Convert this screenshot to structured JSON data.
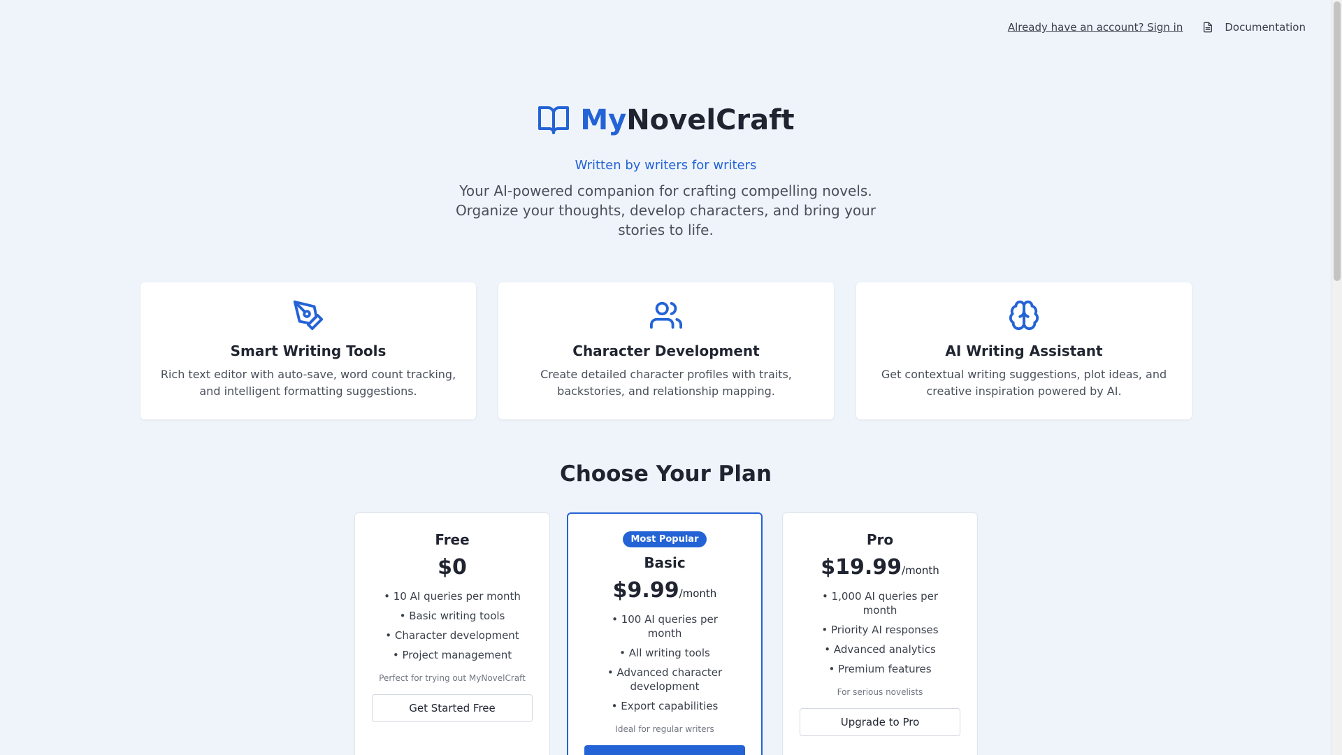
{
  "topnav": {
    "signin_link": "Already have an account? Sign in",
    "documentation": "Documentation"
  },
  "hero": {
    "brand_my": "My",
    "brand_rest": "NovelCraft",
    "tagline": "Written by writers for writers",
    "description": "Your AI-powered companion for crafting compelling novels. Organize your thoughts, develop characters, and bring your stories to life."
  },
  "features": [
    {
      "title": "Smart Writing Tools",
      "description": "Rich text editor with auto-save, word count tracking, and intelligent formatting suggestions.",
      "icon": "pen-tool-icon"
    },
    {
      "title": "Character Development",
      "description": "Create detailed character profiles with traits, backstories, and relationship mapping.",
      "icon": "users-icon"
    },
    {
      "title": "AI Writing Assistant",
      "description": "Get contextual writing suggestions, plot ideas, and creative inspiration powered by AI.",
      "icon": "brain-icon"
    }
  ],
  "plans_title": "Choose Your Plan",
  "plans": [
    {
      "name": "Free",
      "price": "$0",
      "period": "",
      "features": [
        "• 10 AI queries per month",
        "• Basic writing tools",
        "• Character development",
        "• Project management"
      ],
      "note": "Perfect for trying out MyNovelCraft",
      "button": "Get Started Free"
    },
    {
      "badge": "Most Popular",
      "name": "Basic",
      "price": "$9.99",
      "period": "/month",
      "features": [
        "• 100 AI queries per month",
        "• All writing tools",
        "• Advanced character development",
        "• Export capabilities"
      ],
      "note": "Ideal for regular writers",
      "button": ""
    },
    {
      "name": "Pro",
      "price": "$19.99",
      "period": "/month",
      "features": [
        "• 1,000 AI queries per month",
        "• Priority AI responses",
        "• Advanced analytics",
        "• Premium features"
      ],
      "note": "For serious novelists",
      "button": "Upgrade to Pro"
    }
  ],
  "colors": {
    "accent": "#2463d6",
    "background": "#eff4fb"
  }
}
